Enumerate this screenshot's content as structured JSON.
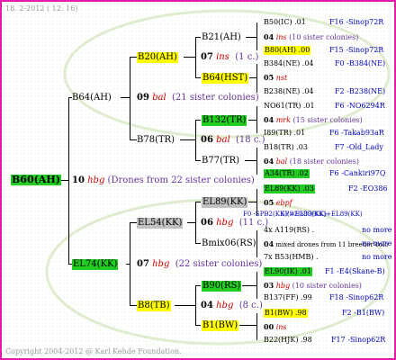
{
  "header": {
    "date": "18. 2-2012 ( 12: 16)"
  },
  "footer": {
    "copyright": "Copyright 2004-2012 @ Karl Kehde Foundation."
  },
  "root": {
    "id": "B60(AH)",
    "gen": "10",
    "species": "hbg",
    "note": "(Drones from 22 sister colonies)"
  },
  "g1": {
    "upper": {
      "id": "B64(AH)",
      "gen": "09",
      "species": "bal",
      "note": "(21 sister colonies)"
    },
    "lower": {
      "id": "EL74(KK)",
      "gen": "07",
      "species": "hbg",
      "note": "(22 sister colonies)"
    }
  },
  "g2": {
    "a": {
      "id": "B20(AH)",
      "gen": "07",
      "species": "ins",
      "note": "(1 c.)"
    },
    "b": {
      "id": "B78(TR)",
      "gen": "06",
      "species": "bal",
      "note": "(18 c.)"
    },
    "c": {
      "id": "EL54(KK)",
      "gen": "06",
      "species": "hbg",
      "note": "(11 c.)"
    },
    "d": {
      "id": "B8(TB)",
      "gen": "04",
      "species": "hbg",
      "note": "(8 c.)"
    }
  },
  "g3": {
    "a1": "B21(AH)",
    "a2": "B64(HST)",
    "b1": "B132(TR)",
    "b2": "B77(TR)",
    "c1": "EL89(KK)",
    "c2": "Bmix06(RS)",
    "d1": "B90(RS)",
    "d2": "B1(BW)"
  },
  "g4": [
    {
      "id": "B50(IC)",
      "val": ".01",
      "ref": "F16 -Sinop72R"
    },
    {
      "gen": "04",
      "species": "ins",
      "note": "(10 sister colonies)"
    },
    {
      "id": "B80(AH)",
      "val": ".00",
      "ref": "F15 -Sinop72R"
    },
    {
      "id": "B384(NE)",
      "val": ".04",
      "ref": "F0 -B384(NE)"
    },
    {
      "gen": "05",
      "species": "nst",
      "note": ""
    },
    {
      "id": "B238(NE)",
      "val": ".04",
      "ref": "F2 -B238(NE)"
    },
    {
      "id": "NO61(TR)",
      "val": ".01",
      "ref": "F6 -NO6294R"
    },
    {
      "gen": "04",
      "species": "mrk",
      "note": "(15 sister colonies)"
    },
    {
      "id": "I89(TR)",
      "val": ".01",
      "ref": "F6 -Takab93aR"
    },
    {
      "id": "B18(TR)",
      "val": ".03",
      "ref": "F7 -Old_Lady"
    },
    {
      "gen": "04",
      "species": "bal",
      "note": "(18 sister colonies)"
    },
    {
      "id": "A34(TR)",
      "val": ".02",
      "ref": "F6 -Cankiri97Q"
    },
    {
      "id": "EL89(KK)",
      "val": ".03",
      "ref": "F2 -EO386"
    },
    {
      "gen": "05",
      "species": "ebpf",
      "note": ""
    },
    {
      "overlap": "F0 -SPB2(KK)(=EL89(KK)+EL89(KK)"
    },
    {
      "overlap2": "SPB2(KK)(KK)"
    },
    {
      "id": "4x A119(RS)",
      "val": ".",
      "ref": "no more"
    },
    {
      "gen": "04",
      "species": "",
      "note": "mixed drones from 11 breeder colo",
      "ref": "no more"
    },
    {
      "id": "7x B53(HMB)",
      "val": ".",
      "ref": "no more"
    },
    {
      "id": "EL90(IK)",
      "val": ".01",
      "ref": "F1 -E4(Skane-B)"
    },
    {
      "gen": "03",
      "species": "hbg",
      "note": "(10 sister colonies)"
    },
    {
      "id": "B137(FF)",
      "val": ".99",
      "ref": "F18 -Sinop62R"
    },
    {
      "id": "B1(BW)",
      "val": ".98",
      "ref": "F2 -B1(BW)"
    },
    {
      "gen": "00",
      "species": "ins",
      "note": ""
    },
    {
      "id": "B22(HJK)",
      "val": ".98",
      "ref": "F17 -Sinop62R"
    }
  ]
}
